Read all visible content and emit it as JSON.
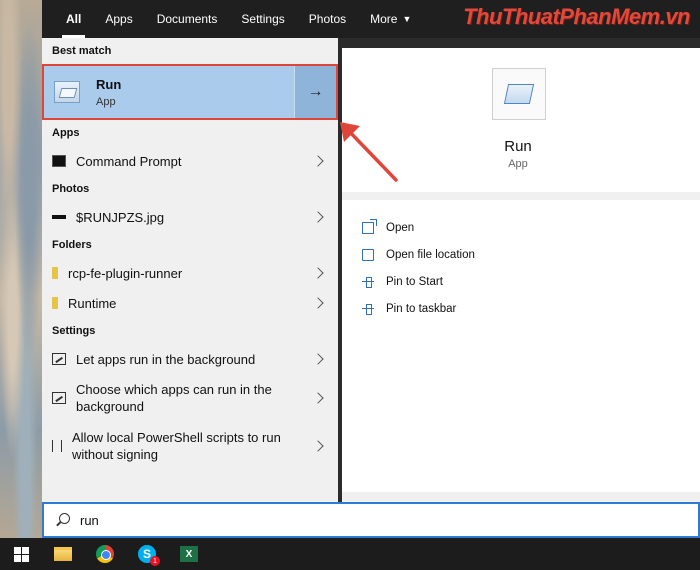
{
  "tabs": [
    {
      "label": "All",
      "active": true
    },
    {
      "label": "Apps"
    },
    {
      "label": "Documents"
    },
    {
      "label": "Settings"
    },
    {
      "label": "Photos"
    },
    {
      "label": "More"
    }
  ],
  "watermark": "ThuThuatPhanMem.vn",
  "best_match": {
    "heading": "Best match",
    "title": "Run",
    "subtitle": "App"
  },
  "apps": {
    "heading": "Apps",
    "items": [
      {
        "label": "Command Prompt",
        "icon": "command-prompt-icon"
      }
    ]
  },
  "photos": {
    "heading": "Photos",
    "items": [
      {
        "label": "$RUNJPZS.jpg",
        "icon": "image-file-icon"
      }
    ]
  },
  "folders": {
    "heading": "Folders",
    "items": [
      {
        "label": "rcp-fe-plugin-runner",
        "icon": "folder-icon"
      },
      {
        "label": "Runtime",
        "icon": "folder-icon"
      }
    ]
  },
  "settings": {
    "heading": "Settings",
    "items": [
      {
        "label": "Let apps run in the background",
        "icon": "settings-icon"
      },
      {
        "label": "Choose which apps can run in the background",
        "icon": "settings-icon"
      },
      {
        "label": "Allow local PowerShell scripts to run without signing",
        "icon": "powershell-settings-icon"
      }
    ]
  },
  "preview": {
    "title": "Run",
    "subtitle": "App",
    "actions": [
      {
        "label": "Open",
        "icon": "open-icon"
      },
      {
        "label": "Open file location",
        "icon": "file-location-icon"
      },
      {
        "label": "Pin to Start",
        "icon": "pin-icon"
      },
      {
        "label": "Pin to taskbar",
        "icon": "pin-icon"
      }
    ]
  },
  "search": {
    "value": "run"
  },
  "taskbar": {
    "items": [
      "windows-start-icon",
      "file-explorer-icon",
      "chrome-icon",
      "skype-icon",
      "excel-icon"
    ],
    "skype_badge": "1",
    "skype_letter": "S",
    "excel_letter": "X"
  },
  "colors": {
    "highlight": "#aacbec",
    "annotation_red": "#e0453a",
    "search_border": "#2f7bd1"
  }
}
